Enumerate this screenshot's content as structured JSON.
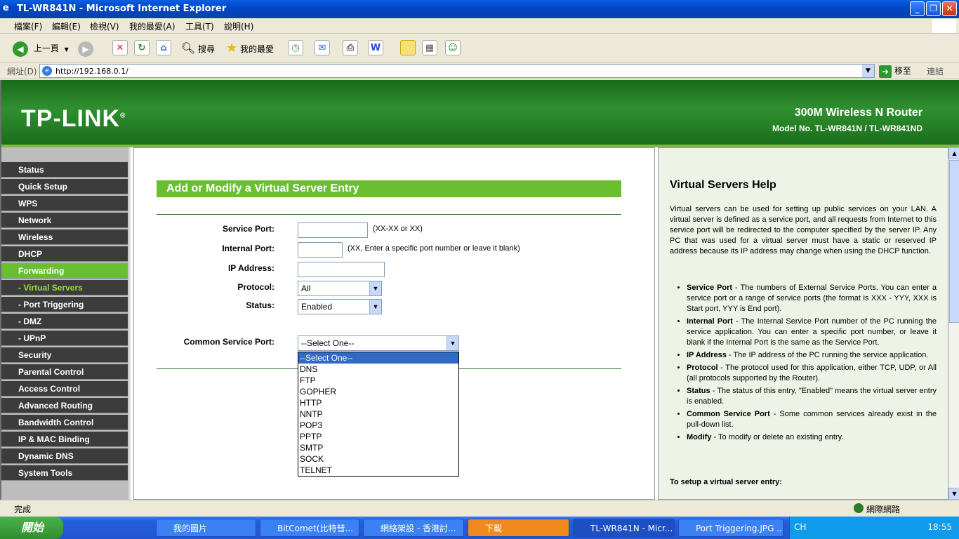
{
  "window": {
    "title": "TL-WR841N - Microsoft Internet Explorer",
    "minimize": "_",
    "maximize": "❐",
    "close": "✕"
  },
  "menu": [
    "檔案(F)",
    "編輯(E)",
    "檢視(V)",
    "我的最愛(A)",
    "工具(T)",
    "說明(H)"
  ],
  "toolbar": {
    "back": "上一頁",
    "search": "搜尋",
    "favorites": "我的最愛"
  },
  "address": {
    "label": "網址(D)",
    "url": "http://192.168.0.1/",
    "go": "移至",
    "links": "連結"
  },
  "banner": {
    "logo": "TP-LINK",
    "product": "300M Wireless N Router",
    "model": "Model No. TL-WR841N / TL-WR841ND"
  },
  "nav": [
    {
      "label": "Status",
      "type": "main"
    },
    {
      "label": "Quick Setup",
      "type": "main"
    },
    {
      "label": "WPS",
      "type": "main"
    },
    {
      "label": "Network",
      "type": "main"
    },
    {
      "label": "Wireless",
      "type": "main"
    },
    {
      "label": "DHCP",
      "type": "main"
    },
    {
      "label": "Forwarding",
      "type": "active"
    },
    {
      "label": "- Virtual Servers",
      "type": "subactive"
    },
    {
      "label": "- Port Triggering",
      "type": "sub"
    },
    {
      "label": "- DMZ",
      "type": "sub"
    },
    {
      "label": "- UPnP",
      "type": "sub"
    },
    {
      "label": "Security",
      "type": "main"
    },
    {
      "label": "Parental Control",
      "type": "main"
    },
    {
      "label": "Access Control",
      "type": "main"
    },
    {
      "label": "Advanced Routing",
      "type": "main"
    },
    {
      "label": "Bandwidth Control",
      "type": "main"
    },
    {
      "label": "IP & MAC Binding",
      "type": "main"
    },
    {
      "label": "Dynamic DNS",
      "type": "main"
    },
    {
      "label": "System Tools",
      "type": "main"
    }
  ],
  "form": {
    "title": "Add or Modify a Virtual Server Entry",
    "service_port_label": "Service Port:",
    "service_port_hint": "(XX-XX or XX)",
    "internal_port_label": "Internal Port:",
    "internal_port_hint": "(XX, Enter a specific port number or leave it blank)",
    "ip_label": "IP Address:",
    "protocol_label": "Protocol:",
    "protocol_value": "All",
    "status_label": "Status:",
    "status_value": "Enabled",
    "common_label": "Common Service Port:",
    "common_value": "--Select One--",
    "common_options": [
      "--Select One--",
      "DNS",
      "FTP",
      "GOPHER",
      "HTTP",
      "NNTP",
      "POP3",
      "PPTP",
      "SMTP",
      "SOCK",
      "TELNET"
    ]
  },
  "help": {
    "title": "Virtual Servers Help",
    "intro": "Virtual servers can be used for setting up public services on your LAN. A virtual server is defined as a service port, and all requests from Internet to this service port will be redirected to the computer specified by the server IP. Any PC that was used for a virtual server must have a static or reserved IP address because its IP address may change when using the DHCP function.",
    "items": [
      {
        "term": "Service Port",
        "text": " - The numbers of External Service Ports. You can enter a service port or a range of service ports (the format is XXX - YYY, XXX is Start port, YYY is End port)."
      },
      {
        "term": "Internal Port",
        "text": " - The Internal Service Port number of the PC running the service application. You can enter a specific port number, or leave it blank if the Internal Port is the same as the Service Port."
      },
      {
        "term": "IP Address",
        "text": " - The IP address of the PC running the service application."
      },
      {
        "term": "Protocol",
        "text": " - The protocol used for this application, either TCP, UDP, or All (all protocols supported by the Router)."
      },
      {
        "term": "Status",
        "text": " - The status of this entry, \"Enabled\" means the virtual server entry is enabled."
      },
      {
        "term": "Common Service Port",
        "text": " - Some common services already exist in the pull-down list."
      },
      {
        "term": "Modify",
        "text": " - To modify or delete an existing entry."
      }
    ],
    "setup": "To setup a virtual server entry:"
  },
  "status": {
    "text": "完成",
    "zone": "網際網路"
  },
  "taskbar": {
    "start": "開始",
    "tasks": [
      {
        "label": "我的圖片",
        "style": "normal"
      },
      {
        "label": "BitComet(比特彗...",
        "style": "normal"
      },
      {
        "label": "網絡架設 - 香港討...",
        "style": "normal"
      },
      {
        "label": "下載",
        "style": "orange"
      },
      {
        "label": "TL-WR841N - Micr...",
        "style": "active"
      },
      {
        "label": "Port Triggering.JPG ...",
        "style": "normal"
      }
    ],
    "lang": "CH",
    "clock": "18:55"
  }
}
